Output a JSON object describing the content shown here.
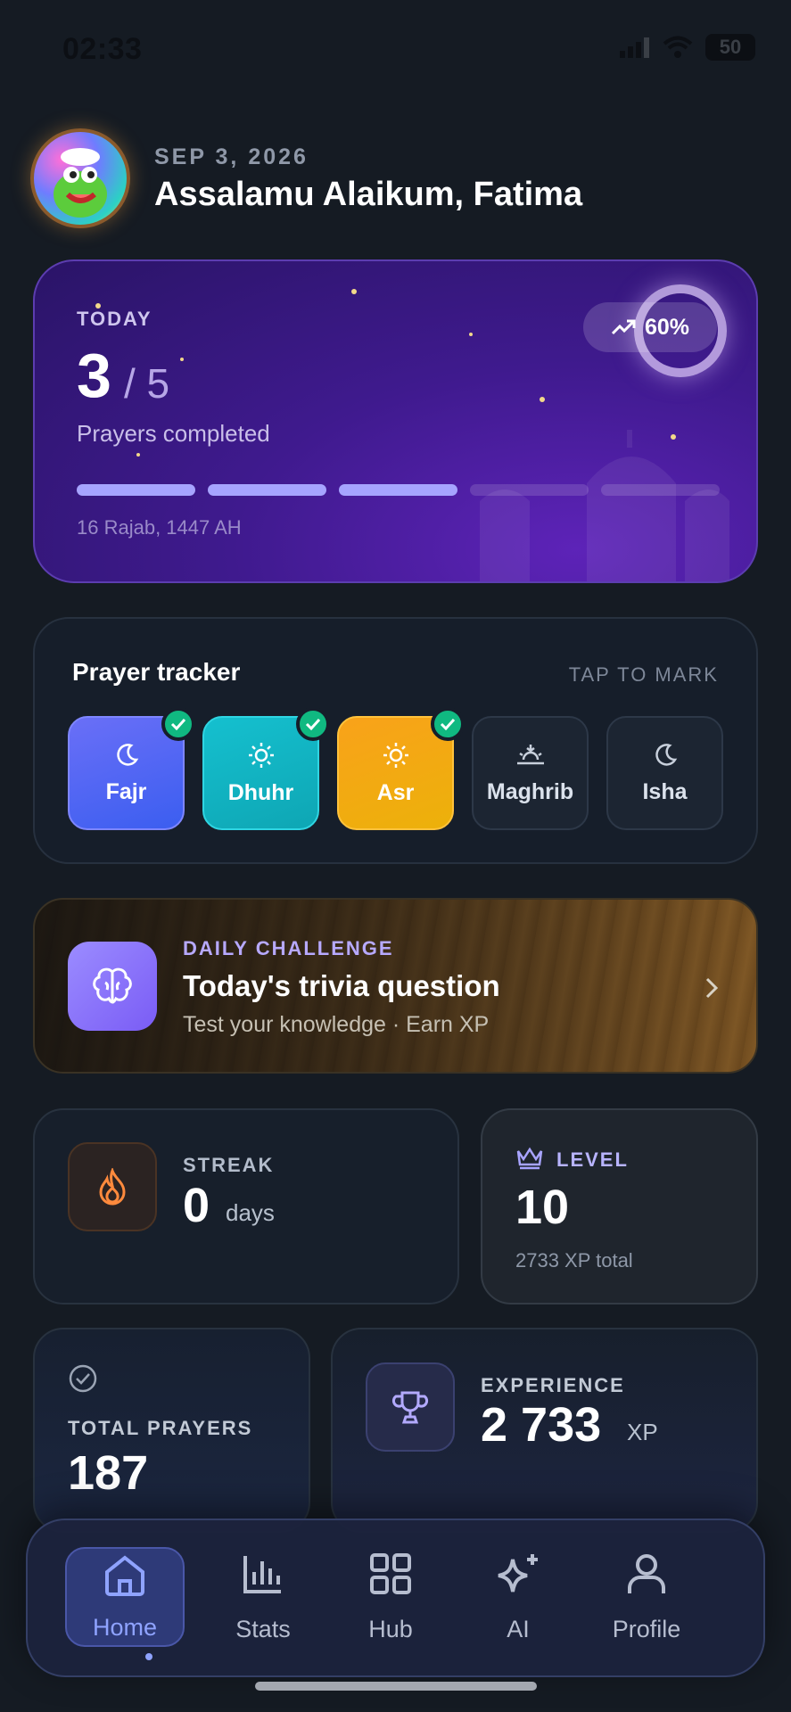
{
  "status_bar": {
    "time": "02:33",
    "battery": "50"
  },
  "header": {
    "date": "SEP 3, 2026",
    "greeting": "Assalamu Alaikum, Fatima"
  },
  "hero": {
    "today_label": "TODAY",
    "completed": "3",
    "total": "/ 5",
    "caption": "Prayers completed",
    "progress_percent": "60%",
    "progress_value": 0.6,
    "bars_completed": 3,
    "bars_total": 5,
    "hijri_date": "16 Rajab, 1447 AH"
  },
  "tracker": {
    "title": "Prayer tracker",
    "hint": "TAP TO MARK",
    "prayers": [
      {
        "name": "Fajr",
        "icon": "moon-icon",
        "done": true,
        "color": "#5b6bf5"
      },
      {
        "name": "Dhuhr",
        "icon": "sun-icon",
        "done": true,
        "color": "#16b8c7"
      },
      {
        "name": "Asr",
        "icon": "sun-icon",
        "done": true,
        "color": "#f4a712"
      },
      {
        "name": "Maghrib",
        "icon": "sunset-icon",
        "done": false,
        "color": "#1c2532"
      },
      {
        "name": "Isha",
        "icon": "moon-icon",
        "done": false,
        "color": "#1c2532"
      }
    ]
  },
  "challenge": {
    "kicker": "DAILY CHALLENGE",
    "title": "Today's trivia question",
    "subtitle": "Test your knowledge · Earn XP",
    "icon": "brain-icon"
  },
  "streak": {
    "label": "STREAK",
    "value": "0",
    "unit": "days",
    "icon": "flame-icon"
  },
  "level": {
    "label": "LEVEL",
    "value": "10",
    "sub": "2733 XP total",
    "icon": "crown-icon"
  },
  "total_prayers": {
    "label": "TOTAL PRAYERS",
    "value": "187",
    "icon": "check-circle-icon"
  },
  "experience": {
    "label": "EXPERIENCE",
    "value": "2 733",
    "unit": "XP",
    "icon": "trophy-icon"
  },
  "nav": {
    "items": [
      {
        "label": "Home",
        "icon": "home-icon",
        "active": true
      },
      {
        "label": "Stats",
        "icon": "bar-chart-icon",
        "active": false
      },
      {
        "label": "Hub",
        "icon": "grid-icon",
        "active": false
      },
      {
        "label": "AI",
        "icon": "sparkles-icon",
        "active": false
      },
      {
        "label": "Profile",
        "icon": "user-icon",
        "active": false
      }
    ]
  },
  "colors": {
    "background": "#151b23",
    "accent": "#8fa3ff",
    "success": "#10b981",
    "hero": "#3f1a8e"
  }
}
